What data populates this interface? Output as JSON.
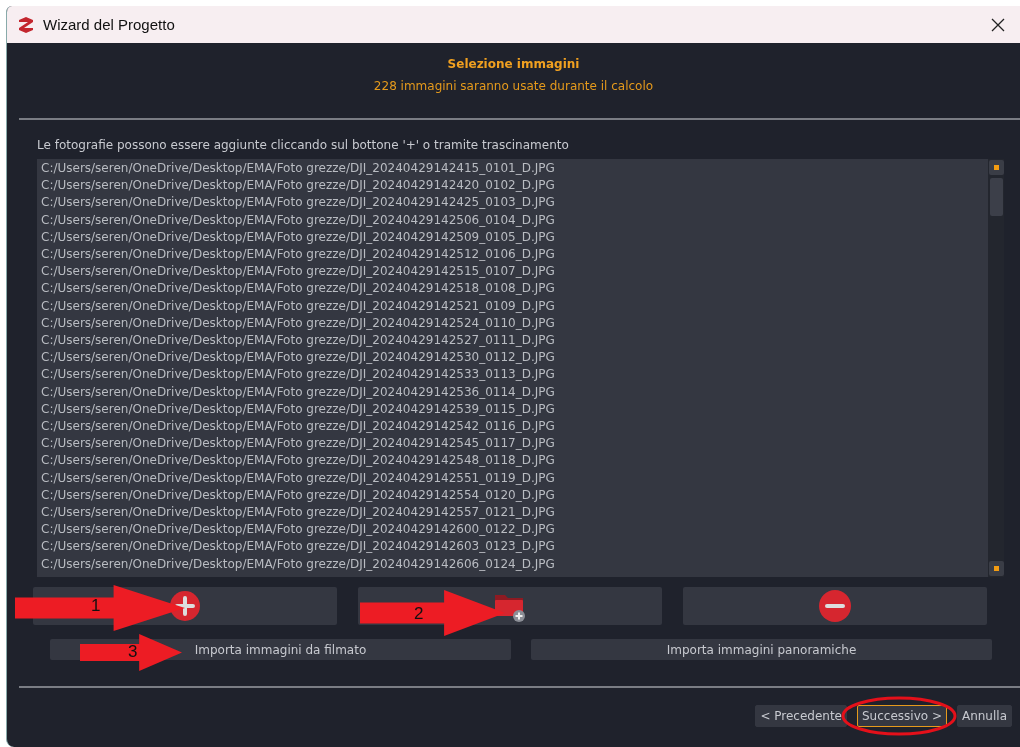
{
  "window": {
    "title": "Wizard del Progetto"
  },
  "header": {
    "title": "Selezione immagini",
    "subtitle": "228 immagini saranno usate durante il calcolo"
  },
  "instruction": "Le fotografie possono essere aggiunte cliccando sul bottone '+' o tramite trascinamento",
  "files": [
    "C:/Users/seren/OneDrive/Desktop/EMA/Foto grezze/DJI_20240429142415_0101_D.JPG",
    "C:/Users/seren/OneDrive/Desktop/EMA/Foto grezze/DJI_20240429142420_0102_D.JPG",
    "C:/Users/seren/OneDrive/Desktop/EMA/Foto grezze/DJI_20240429142425_0103_D.JPG",
    "C:/Users/seren/OneDrive/Desktop/EMA/Foto grezze/DJI_20240429142506_0104_D.JPG",
    "C:/Users/seren/OneDrive/Desktop/EMA/Foto grezze/DJI_20240429142509_0105_D.JPG",
    "C:/Users/seren/OneDrive/Desktop/EMA/Foto grezze/DJI_20240429142512_0106_D.JPG",
    "C:/Users/seren/OneDrive/Desktop/EMA/Foto grezze/DJI_20240429142515_0107_D.JPG",
    "C:/Users/seren/OneDrive/Desktop/EMA/Foto grezze/DJI_20240429142518_0108_D.JPG",
    "C:/Users/seren/OneDrive/Desktop/EMA/Foto grezze/DJI_20240429142521_0109_D.JPG",
    "C:/Users/seren/OneDrive/Desktop/EMA/Foto grezze/DJI_20240429142524_0110_D.JPG",
    "C:/Users/seren/OneDrive/Desktop/EMA/Foto grezze/DJI_20240429142527_0111_D.JPG",
    "C:/Users/seren/OneDrive/Desktop/EMA/Foto grezze/DJI_20240429142530_0112_D.JPG",
    "C:/Users/seren/OneDrive/Desktop/EMA/Foto grezze/DJI_20240429142533_0113_D.JPG",
    "C:/Users/seren/OneDrive/Desktop/EMA/Foto grezze/DJI_20240429142536_0114_D.JPG",
    "C:/Users/seren/OneDrive/Desktop/EMA/Foto grezze/DJI_20240429142539_0115_D.JPG",
    "C:/Users/seren/OneDrive/Desktop/EMA/Foto grezze/DJI_20240429142542_0116_D.JPG",
    "C:/Users/seren/OneDrive/Desktop/EMA/Foto grezze/DJI_20240429142545_0117_D.JPG",
    "C:/Users/seren/OneDrive/Desktop/EMA/Foto grezze/DJI_20240429142548_0118_D.JPG",
    "C:/Users/seren/OneDrive/Desktop/EMA/Foto grezze/DJI_20240429142551_0119_D.JPG",
    "C:/Users/seren/OneDrive/Desktop/EMA/Foto grezze/DJI_20240429142554_0120_D.JPG",
    "C:/Users/seren/OneDrive/Desktop/EMA/Foto grezze/DJI_20240429142557_0121_D.JPG",
    "C:/Users/seren/OneDrive/Desktop/EMA/Foto grezze/DJI_20240429142600_0122_D.JPG",
    "C:/Users/seren/OneDrive/Desktop/EMA/Foto grezze/DJI_20240429142603_0123_D.JPG",
    "C:/Users/seren/OneDrive/Desktop/EMA/Foto grezze/DJI_20240429142606_0124_D.JPG"
  ],
  "tool_buttons": [
    {
      "kind": "add"
    },
    {
      "kind": "add-folder"
    },
    {
      "kind": "remove"
    }
  ],
  "import_buttons": [
    "Importa immagini da filmato",
    "Importa immagini panoramiche"
  ],
  "footer_buttons": [
    {
      "label": "< Precedente",
      "focused": false,
      "circled": false
    },
    {
      "label": "Successivo >",
      "focused": true,
      "circled": true
    },
    {
      "label": "Annulla",
      "focused": false,
      "circled": false
    }
  ],
  "annotations": [
    {
      "label": "1"
    },
    {
      "label": "2"
    },
    {
      "label": "3"
    }
  ]
}
